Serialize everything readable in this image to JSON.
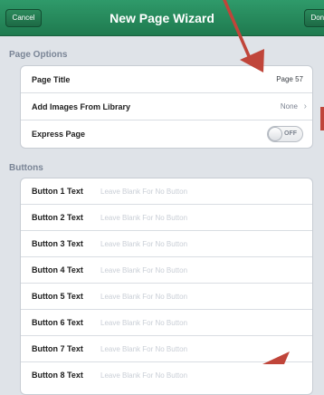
{
  "navbar": {
    "title": "New Page Wizard",
    "cancel_label": "Cancel",
    "done_label": "Done"
  },
  "page_options": {
    "header": "Page Options",
    "page_title_label": "Page Title",
    "page_title_value": "Page 57",
    "add_images_label": "Add Images From Library",
    "add_images_value": "None",
    "express_page_label": "Express Page",
    "express_page_toggle": "OFF"
  },
  "buttons": {
    "header": "Buttons",
    "placeholder": "Leave Blank For No Button",
    "items": [
      {
        "label": "Button 1 Text"
      },
      {
        "label": "Button 2 Text"
      },
      {
        "label": "Button 3 Text"
      },
      {
        "label": "Button 4 Text"
      },
      {
        "label": "Button 5 Text"
      },
      {
        "label": "Button 6 Text"
      },
      {
        "label": "Button 7 Text"
      },
      {
        "label": "Button 8 Text"
      }
    ]
  },
  "colors": {
    "nav_green": "#1f7a4f",
    "annotation_red": "#c0453a"
  }
}
